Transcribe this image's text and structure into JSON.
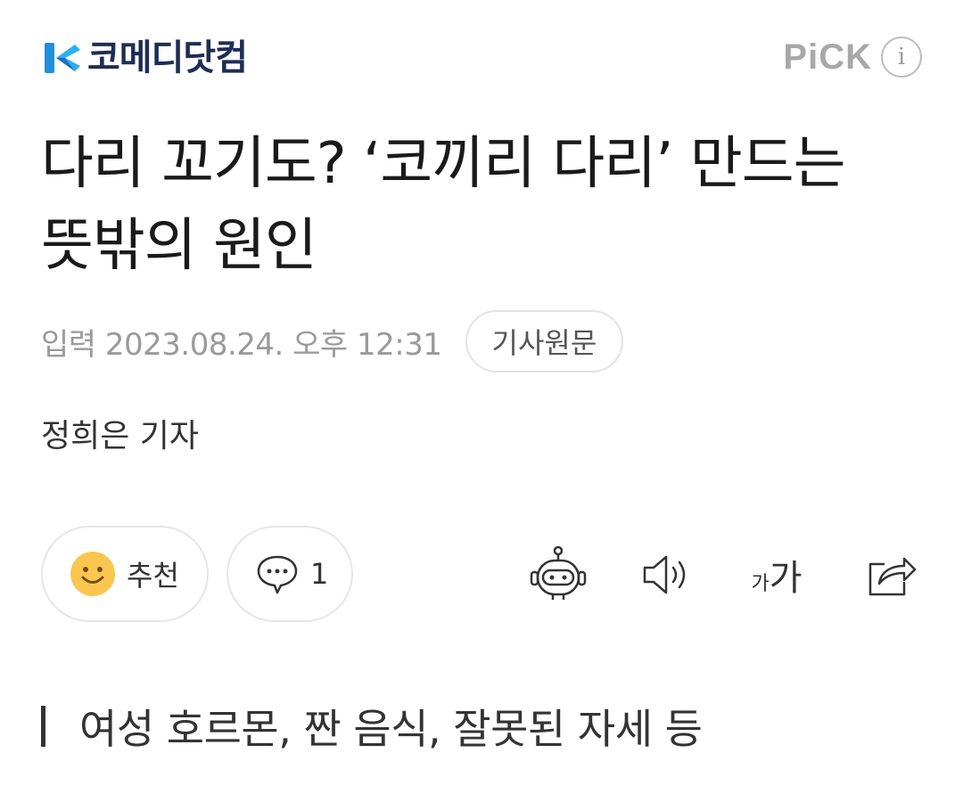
{
  "header": {
    "logo_text": "코메디닷컴",
    "logo_icon": "comedy-logo-icon",
    "pick_label": "PiCK",
    "info_glyph": "i"
  },
  "article": {
    "headline": "다리 꼬기도? ‘코끼리 다리’ 만드는 뜻밖의 원인",
    "date": "입력 2023.08.24. 오후 12:31",
    "source_button": "기사원문",
    "reporter": "정희은 기자",
    "subheading": "여성 호르몬, 짠 음식, 잘못된 자세 등"
  },
  "actions": {
    "recommend_label": "추천",
    "comment_count": "1",
    "icons": [
      "smile-icon",
      "comment-icon",
      "robot-summary-icon",
      "speaker-icon",
      "font-size-icon",
      "share-icon"
    ],
    "font_small": "가",
    "font_large": "가"
  },
  "colors": {
    "logo_blue": "#1e90e0",
    "logo_navy": "#1e2d55",
    "muted_gray": "#9a9a9a",
    "smile_yellow": "#f9c74f"
  }
}
